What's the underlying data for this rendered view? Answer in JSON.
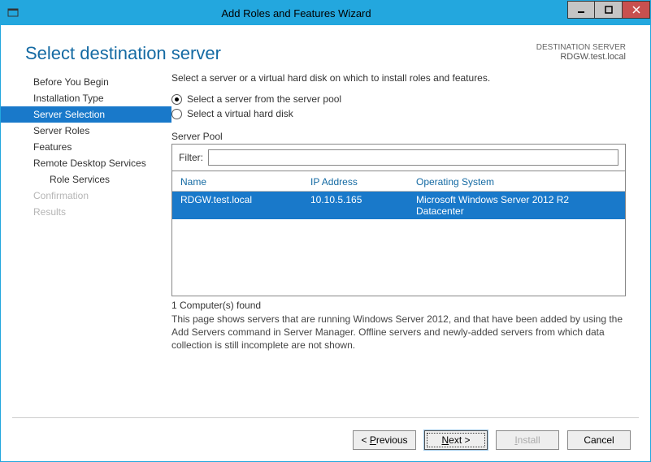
{
  "window": {
    "title": "Add Roles and Features Wizard"
  },
  "header": {
    "page_title": "Select destination server",
    "dest_label": "DESTINATION SERVER",
    "dest_value": "RDGW.test.local"
  },
  "nav": {
    "items": [
      {
        "label": "Before You Begin"
      },
      {
        "label": "Installation Type"
      },
      {
        "label": "Server Selection"
      },
      {
        "label": "Server Roles"
      },
      {
        "label": "Features"
      },
      {
        "label": "Remote Desktop Services"
      },
      {
        "label": "Role Services"
      },
      {
        "label": "Confirmation"
      },
      {
        "label": "Results"
      }
    ]
  },
  "main": {
    "instruction": "Select a server or a virtual hard disk on which to install roles and features.",
    "radio1": "Select a server from the server pool",
    "radio2": "Select a virtual hard disk",
    "pool_label": "Server Pool",
    "filter_label": "Filter:",
    "filter_value": "",
    "columns": {
      "name": "Name",
      "ip": "IP Address",
      "os": "Operating System"
    },
    "rows": [
      {
        "name": "RDGW.test.local",
        "ip": "10.10.5.165",
        "os": "Microsoft Windows Server 2012 R2 Datacenter"
      }
    ],
    "found_text": "1 Computer(s) found",
    "help_text": "This page shows servers that are running Windows Server 2012, and that have been added by using the Add Servers command in Server Manager. Offline servers and newly-added servers from which data collection is still incomplete are not shown."
  },
  "footer": {
    "previous": "< Previous",
    "next": "Next >",
    "install": "Install",
    "cancel": "Cancel"
  }
}
